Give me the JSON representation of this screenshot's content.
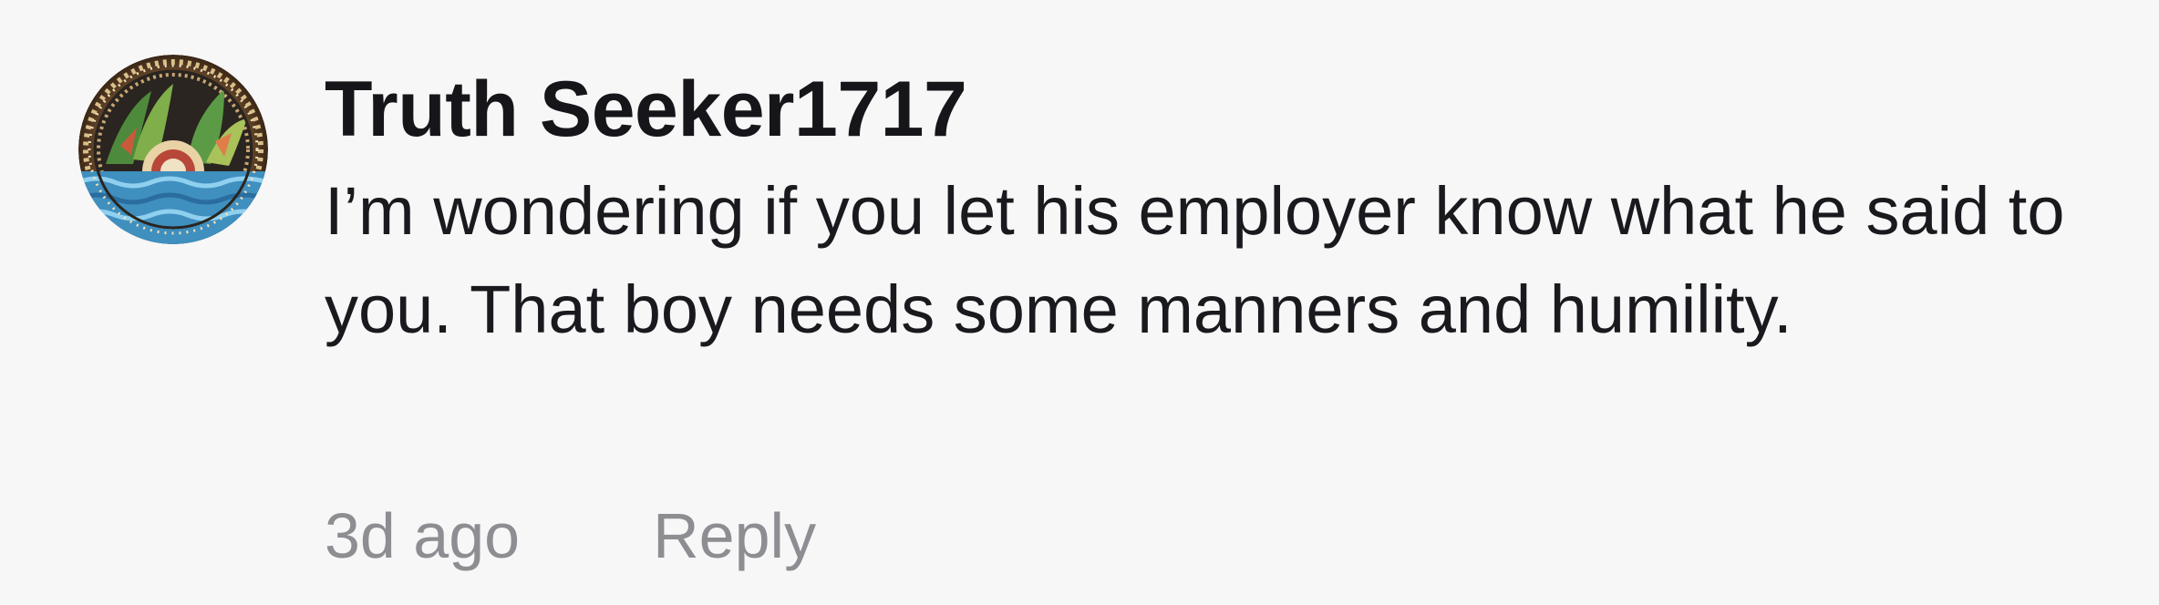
{
  "comment": {
    "author": "Truth Seeker1717",
    "avatar_icon": "user-avatar-mandala-icon",
    "text": "I’m wondering if you let his employer know what he said to you. That boy needs some manners and humility.",
    "timestamp": "3d ago",
    "reply_label": "Reply"
  },
  "colors": {
    "background": "#f7f7f8",
    "author_text": "#16161a",
    "body_text": "#1a1a1e",
    "meta_text": "#8d8d92"
  }
}
